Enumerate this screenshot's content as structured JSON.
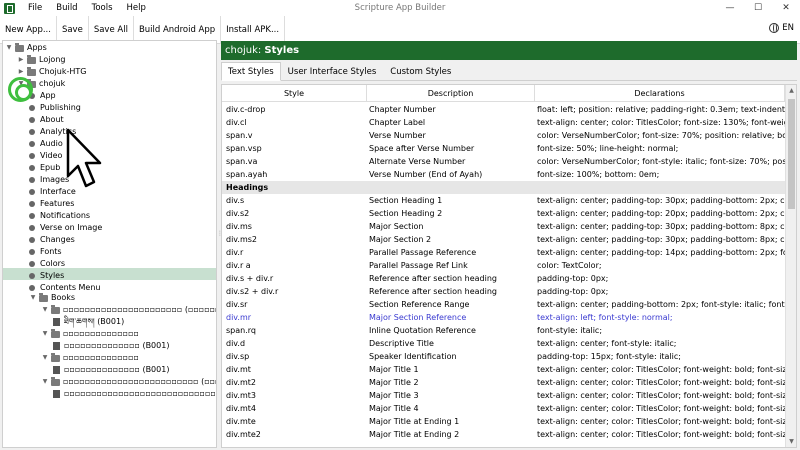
{
  "window": {
    "title": "Scripture App Builder",
    "minimize": "—",
    "maximize": "☐",
    "close": "✕"
  },
  "menu": [
    "File",
    "Build",
    "Tools",
    "Help"
  ],
  "toolbar": {
    "buttons": [
      "New App...",
      "Save",
      "Save All",
      "Build Android App",
      "Install APK..."
    ],
    "language": "EN"
  },
  "tree": {
    "root": "Apps",
    "apps": [
      "Lojong",
      "Chojuk-HTG",
      "chojuk"
    ],
    "features": [
      "App",
      "Publishing",
      "About",
      "Analytics",
      "Audio",
      "Video",
      "Epub",
      "Images",
      "Interface",
      "Features",
      "Notifications",
      "Verse on Image",
      "Changes",
      "Fonts",
      "Colors",
      "Styles",
      "Contents Menu"
    ],
    "selected_feature": "Styles",
    "books_label": "Books",
    "books": [
      {
        "folder": "▫▫▫▫▫▫▫▫▫▫▫▫▫▫▫▫▫▫▫▫▫▫ (▫▫▫▫▫▫▫▫▫▫▫▫)",
        "item": "ཐིག་ཆགས། (B001)"
      },
      {
        "folder": "▫▫▫▫▫▫▫▫▫▫▫▫▫▫",
        "item": "▫▫▫▫▫▫▫▫▫▫▫▫▫▫ (B001)"
      },
      {
        "folder": "▫▫▫▫▫▫▫▫▫▫▫▫▫▫",
        "item": "▫▫▫▫▫▫▫▫▫▫▫▫▫▫ (B001)"
      },
      {
        "folder": "▫▫▫▫▫▫▫▫▫▫▫▫▫▫▫▫▫▫▫▫▫▫▫▫▫ (▫▫▫▫▫▫▫▫▫▫▫▫)",
        "item": "▫▫▫▫▫▫▫▫▫▫▫▫▫▫▫▫▫▫▫▫▫▫▫▫▫▫▫▫▫ (B001)"
      }
    ]
  },
  "pane": {
    "app_name": "chojuk:",
    "page_title": "Styles",
    "tabs": [
      "Text Styles",
      "User Interface Styles",
      "Custom Styles"
    ],
    "active_tab": 0,
    "columns": [
      "Style",
      "Description",
      "Declarations"
    ],
    "rows": [
      {
        "style": "div.c-drop",
        "desc": "Chapter Number",
        "decl": "float: left; position: relative; padding-right: 0.3em; text-indent: 0; co..."
      },
      {
        "style": "div.cl",
        "desc": "Chapter Label",
        "decl": "text-align: center; color: TitlesColor; font-size: 130%; font-weight: bo..."
      },
      {
        "style": "span.v",
        "desc": "Verse Number",
        "decl": "color: VerseNumberColor; font-size: 70%; position: relative; botto..."
      },
      {
        "style": "span.vsp",
        "desc": "Space after Verse Number",
        "decl": "font-size: 50%; line-height: normal;"
      },
      {
        "style": "span.va",
        "desc": "Alternate Verse Number",
        "decl": "color: VerseNumberColor; font-style: italic; font-size: 70%; position..."
      },
      {
        "style": "span.ayah",
        "desc": "Verse Number (End of Ayah)",
        "decl": "font-size: 100%; bottom: 0em;"
      },
      {
        "section": "Headings"
      },
      {
        "style": "div.s",
        "desc": "Section Heading 1",
        "decl": "text-align: center; padding-top: 30px; padding-bottom: 2px; color:..."
      },
      {
        "style": "div.s2",
        "desc": "Section Heading 2",
        "decl": "text-align: center; padding-top: 20px; padding-bottom: 2px; color:..."
      },
      {
        "style": "div.ms",
        "desc": "Major Section",
        "decl": "text-align: center; padding-top: 30px; padding-bottom: 8px; color:..."
      },
      {
        "style": "div.ms2",
        "desc": "Major Section 2",
        "decl": "text-align: center; padding-top: 30px; padding-bottom: 8px; color:..."
      },
      {
        "style": "div.r",
        "desc": "Parallel Passage Reference",
        "decl": "text-align: center; padding-top: 14px; padding-bottom: 2px; font-..."
      },
      {
        "style": "div.r a",
        "desc": "Parallel Passage Ref Link",
        "decl": "color: TextColor;"
      },
      {
        "style": "div.s + div.r",
        "desc": "Reference after section heading",
        "decl": "padding-top: 0px;"
      },
      {
        "style": "div.s2 + div.r",
        "desc": "Reference after section heading",
        "decl": "padding-top: 0px;"
      },
      {
        "style": "div.sr",
        "desc": "Section Reference Range",
        "decl": "text-align: center; padding-bottom: 2px; font-style: italic; font-size:..."
      },
      {
        "style": "div.mr",
        "desc": "Major Section Reference",
        "decl": "text-align: left; font-style: normal;",
        "blue": true
      },
      {
        "style": "span.rq",
        "desc": "Inline Quotation Reference",
        "decl": "font-style: italic;"
      },
      {
        "style": "div.d",
        "desc": "Descriptive Title",
        "decl": "text-align: center; font-style: italic;"
      },
      {
        "style": "div.sp",
        "desc": "Speaker Identification",
        "decl": "padding-top: 15px; font-style: italic;"
      },
      {
        "style": "div.mt",
        "desc": "Major Title 1",
        "decl": "text-align: center; color: TitlesColor; font-weight: bold; font-size: 15..."
      },
      {
        "style": "div.mt2",
        "desc": "Major Title 2",
        "decl": "text-align: center; color: TitlesColor; font-weight: bold; font-size: 11..."
      },
      {
        "style": "div.mt3",
        "desc": "Major Title 3",
        "decl": "text-align: center; color: TitlesColor; font-weight: bold; font-size: 11..."
      },
      {
        "style": "div.mt4",
        "desc": "Major Title 4",
        "decl": "text-align: center; color: TitlesColor; font-weight: bold; font-size: 90..."
      },
      {
        "style": "div.mte",
        "desc": "Major Title at Ending 1",
        "decl": "text-align: center; color: TitlesColor; font-weight: bold; font-size: 15..."
      },
      {
        "style": "div.mte2",
        "desc": "Major Title at Ending 2",
        "decl": "text-align: center; color: TitlesColor; font-weight: bold; font-size: 11..."
      }
    ]
  },
  "colors": {
    "brand": "#1e6b2c",
    "selection": "#c8e0d0",
    "link_blue": "#3a3ad0",
    "click_ring": "#3fbf3f"
  }
}
